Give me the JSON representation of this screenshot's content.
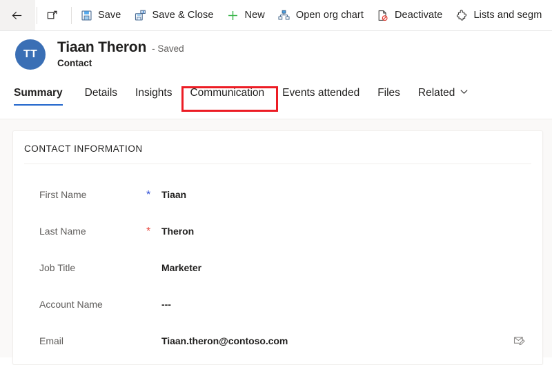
{
  "commandbar": {
    "buttons": [
      {
        "icon": "back-arrow-icon",
        "label": "",
        "name": "back-button"
      },
      {
        "icon": "popout-icon",
        "label": "",
        "name": "open-in-new-window-button"
      },
      {
        "icon": "save-icon",
        "label": "Save",
        "name": "save-button"
      },
      {
        "icon": "save-close-icon",
        "label": "Save & Close",
        "name": "save-and-close-button"
      },
      {
        "icon": "plus-icon",
        "label": "New",
        "name": "new-button"
      },
      {
        "icon": "org-chart-icon",
        "label": "Open org chart",
        "name": "open-org-chart-button"
      },
      {
        "icon": "deactivate-icon",
        "label": "Deactivate",
        "name": "deactivate-button"
      },
      {
        "icon": "lists-segments-icon",
        "label": "Lists and segm",
        "name": "lists-and-segments-button"
      }
    ]
  },
  "record": {
    "avatar_initials": "TT",
    "name": "Tiaan Theron",
    "status": "- Saved",
    "entity": "Contact"
  },
  "tabs": [
    {
      "label": "Summary",
      "selected": true,
      "highlighted": false,
      "chevron": false
    },
    {
      "label": "Details",
      "selected": false,
      "highlighted": false,
      "chevron": false
    },
    {
      "label": "Insights",
      "selected": false,
      "highlighted": false,
      "chevron": false
    },
    {
      "label": "Communication",
      "selected": false,
      "highlighted": true,
      "chevron": false
    },
    {
      "label": "Events attended",
      "selected": false,
      "highlighted": false,
      "chevron": false
    },
    {
      "label": "Files",
      "selected": false,
      "highlighted": false,
      "chevron": false
    },
    {
      "label": "Related",
      "selected": false,
      "highlighted": false,
      "chevron": true
    }
  ],
  "card": {
    "title": "CONTACT INFORMATION",
    "fields": [
      {
        "label": "First Name",
        "required": "recommended",
        "value": "Tiaan",
        "action": null
      },
      {
        "label": "Last Name",
        "required": "required",
        "value": "Theron",
        "action": null
      },
      {
        "label": "Job Title",
        "required": "none",
        "value": "Marketer",
        "action": null
      },
      {
        "label": "Account Name",
        "required": "none",
        "value": "---",
        "action": null
      },
      {
        "label": "Email",
        "required": "none",
        "value": "Tiaan.theron@contoso.com",
        "action": "send-email-icon"
      }
    ]
  },
  "annotation": {
    "target_tab": "Communication",
    "color": "#ec1c24"
  },
  "colors": {
    "accent": "#2266cc",
    "avatar": "#3a6fb5",
    "required": "#e8483f",
    "recommended": "#2b4bd4",
    "canvas": "#faf9f8",
    "annotation": "#ec1c24"
  }
}
